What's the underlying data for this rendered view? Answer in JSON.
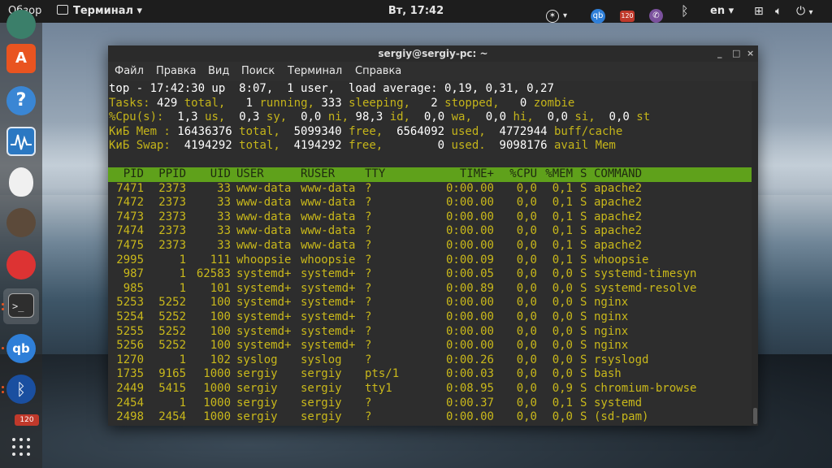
{
  "topbar": {
    "overview": "Обзор",
    "app_name": "Терминал",
    "clock": "Вт, 17:42",
    "lang": "en",
    "badge": "120"
  },
  "dock": {
    "badge": "120"
  },
  "window": {
    "title": "sergiy@sergiy-pc: ~",
    "controls": [
      "_",
      "□",
      "×"
    ],
    "menu": [
      "Файл",
      "Правка",
      "Вид",
      "Поиск",
      "Терминал",
      "Справка"
    ]
  },
  "top": {
    "line1": "top - 17:42:30 up  8:07,  1 user,  load average: 0,19, 0,31, 0,27",
    "tasks": {
      "label": "Tasks:",
      "total": "429",
      "total_l": "total,",
      "running": "1",
      "running_l": "running,",
      "sleeping": "333",
      "sleeping_l": "sleeping,",
      "stopped": "2",
      "stopped_l": "stopped,",
      "zombie": "0",
      "zombie_l": "zombie"
    },
    "cpu": {
      "label": "%Cpu(s):",
      "us": "1,3",
      "us_l": "us,",
      "sy": "0,3",
      "sy_l": "sy,",
      "ni": "0,0",
      "ni_l": "ni,",
      "id": "98,3",
      "id_l": "id,",
      "wa": "0,0",
      "wa_l": "wa,",
      "hi": "0,0",
      "hi_l": "hi,",
      "si": "0,0",
      "si_l": "si,",
      "st": "0,0",
      "st_l": "st"
    },
    "mem": {
      "label": "КиБ Mem :",
      "total": "16436376",
      "total_l": "total,",
      "free": "5099340",
      "free_l": "free,",
      "used": "6564092",
      "used_l": "used,",
      "buff": "4772944",
      "buff_l": "buff/cache"
    },
    "swap": {
      "label": "КиБ Swap:",
      "total": "4194292",
      "total_l": "total,",
      "free": "4194292",
      "free_l": "free,",
      "used": "0",
      "used_l": "used.",
      "avail": "9098176",
      "avail_l": "avail Mem"
    }
  },
  "table": {
    "headers": [
      "PID",
      "PPID",
      "UID",
      "USER",
      "RUSER",
      "TTY",
      "TIME+",
      "%CPU",
      "%MEM",
      "S",
      "COMMAND"
    ],
    "rows": [
      [
        "7471",
        "2373",
        "33",
        "www-data",
        "www-data",
        "?",
        "0:00.00",
        "0,0",
        "0,1",
        "S",
        "apache2"
      ],
      [
        "7472",
        "2373",
        "33",
        "www-data",
        "www-data",
        "?",
        "0:00.00",
        "0,0",
        "0,1",
        "S",
        "apache2"
      ],
      [
        "7473",
        "2373",
        "33",
        "www-data",
        "www-data",
        "?",
        "0:00.00",
        "0,0",
        "0,1",
        "S",
        "apache2"
      ],
      [
        "7474",
        "2373",
        "33",
        "www-data",
        "www-data",
        "?",
        "0:00.00",
        "0,0",
        "0,1",
        "S",
        "apache2"
      ],
      [
        "7475",
        "2373",
        "33",
        "www-data",
        "www-data",
        "?",
        "0:00.00",
        "0,0",
        "0,1",
        "S",
        "apache2"
      ],
      [
        "2995",
        "1",
        "111",
        "whoopsie",
        "whoopsie",
        "?",
        "0:00.09",
        "0,0",
        "0,1",
        "S",
        "whoopsie"
      ],
      [
        "987",
        "1",
        "62583",
        "systemd+",
        "systemd+",
        "?",
        "0:00.05",
        "0,0",
        "0,0",
        "S",
        "systemd-timesyn"
      ],
      [
        "985",
        "1",
        "101",
        "systemd+",
        "systemd+",
        "?",
        "0:00.89",
        "0,0",
        "0,0",
        "S",
        "systemd-resolve"
      ],
      [
        "5253",
        "5252",
        "100",
        "systemd+",
        "systemd+",
        "?",
        "0:00.00",
        "0,0",
        "0,0",
        "S",
        "nginx"
      ],
      [
        "5254",
        "5252",
        "100",
        "systemd+",
        "systemd+",
        "?",
        "0:00.00",
        "0,0",
        "0,0",
        "S",
        "nginx"
      ],
      [
        "5255",
        "5252",
        "100",
        "systemd+",
        "systemd+",
        "?",
        "0:00.00",
        "0,0",
        "0,0",
        "S",
        "nginx"
      ],
      [
        "5256",
        "5252",
        "100",
        "systemd+",
        "systemd+",
        "?",
        "0:00.00",
        "0,0",
        "0,0",
        "S",
        "nginx"
      ],
      [
        "1270",
        "1",
        "102",
        "syslog",
        "syslog",
        "?",
        "0:00.26",
        "0,0",
        "0,0",
        "S",
        "rsyslogd"
      ],
      [
        "1735",
        "9165",
        "1000",
        "sergiy",
        "sergiy",
        "pts/1",
        "0:00.03",
        "0,0",
        "0,0",
        "S",
        "bash"
      ],
      [
        "2449",
        "5415",
        "1000",
        "sergiy",
        "sergiy",
        "tty1",
        "0:08.95",
        "0,0",
        "0,9",
        "S",
        "chromium-browse"
      ],
      [
        "2454",
        "1",
        "1000",
        "sergiy",
        "sergiy",
        "?",
        "0:00.37",
        "0,0",
        "0,1",
        "S",
        "systemd"
      ],
      [
        "2498",
        "2454",
        "1000",
        "sergiy",
        "sergiy",
        "?",
        "0:00.00",
        "0,0",
        "0,0",
        "S",
        "(sd-pam)"
      ]
    ]
  },
  "colors": {
    "header_bg": "#5fa11b",
    "text_yellow": "#c4b41a",
    "topbar_bg": "#1d1d1d"
  }
}
